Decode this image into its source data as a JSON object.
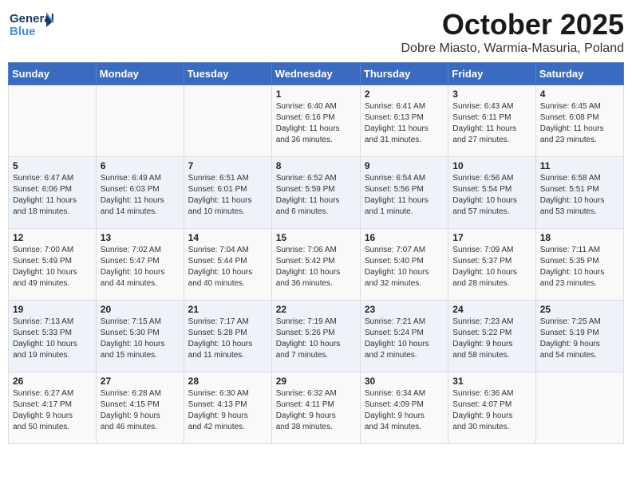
{
  "logo": {
    "line1": "General",
    "line2": "Blue"
  },
  "title": "October 2025",
  "subtitle": "Dobre Miasto, Warmia-Masuria, Poland",
  "days_of_week": [
    "Sunday",
    "Monday",
    "Tuesday",
    "Wednesday",
    "Thursday",
    "Friday",
    "Saturday"
  ],
  "weeks": [
    [
      {
        "day": "",
        "info": ""
      },
      {
        "day": "",
        "info": ""
      },
      {
        "day": "",
        "info": ""
      },
      {
        "day": "1",
        "info": "Sunrise: 6:40 AM\nSunset: 6:16 PM\nDaylight: 11 hours\nand 36 minutes."
      },
      {
        "day": "2",
        "info": "Sunrise: 6:41 AM\nSunset: 6:13 PM\nDaylight: 11 hours\nand 31 minutes."
      },
      {
        "day": "3",
        "info": "Sunrise: 6:43 AM\nSunset: 6:11 PM\nDaylight: 11 hours\nand 27 minutes."
      },
      {
        "day": "4",
        "info": "Sunrise: 6:45 AM\nSunset: 6:08 PM\nDaylight: 11 hours\nand 23 minutes."
      }
    ],
    [
      {
        "day": "5",
        "info": "Sunrise: 6:47 AM\nSunset: 6:06 PM\nDaylight: 11 hours\nand 18 minutes."
      },
      {
        "day": "6",
        "info": "Sunrise: 6:49 AM\nSunset: 6:03 PM\nDaylight: 11 hours\nand 14 minutes."
      },
      {
        "day": "7",
        "info": "Sunrise: 6:51 AM\nSunset: 6:01 PM\nDaylight: 11 hours\nand 10 minutes."
      },
      {
        "day": "8",
        "info": "Sunrise: 6:52 AM\nSunset: 5:59 PM\nDaylight: 11 hours\nand 6 minutes."
      },
      {
        "day": "9",
        "info": "Sunrise: 6:54 AM\nSunset: 5:56 PM\nDaylight: 11 hours\nand 1 minute."
      },
      {
        "day": "10",
        "info": "Sunrise: 6:56 AM\nSunset: 5:54 PM\nDaylight: 10 hours\nand 57 minutes."
      },
      {
        "day": "11",
        "info": "Sunrise: 6:58 AM\nSunset: 5:51 PM\nDaylight: 10 hours\nand 53 minutes."
      }
    ],
    [
      {
        "day": "12",
        "info": "Sunrise: 7:00 AM\nSunset: 5:49 PM\nDaylight: 10 hours\nand 49 minutes."
      },
      {
        "day": "13",
        "info": "Sunrise: 7:02 AM\nSunset: 5:47 PM\nDaylight: 10 hours\nand 44 minutes."
      },
      {
        "day": "14",
        "info": "Sunrise: 7:04 AM\nSunset: 5:44 PM\nDaylight: 10 hours\nand 40 minutes."
      },
      {
        "day": "15",
        "info": "Sunrise: 7:06 AM\nSunset: 5:42 PM\nDaylight: 10 hours\nand 36 minutes."
      },
      {
        "day": "16",
        "info": "Sunrise: 7:07 AM\nSunset: 5:40 PM\nDaylight: 10 hours\nand 32 minutes."
      },
      {
        "day": "17",
        "info": "Sunrise: 7:09 AM\nSunset: 5:37 PM\nDaylight: 10 hours\nand 28 minutes."
      },
      {
        "day": "18",
        "info": "Sunrise: 7:11 AM\nSunset: 5:35 PM\nDaylight: 10 hours\nand 23 minutes."
      }
    ],
    [
      {
        "day": "19",
        "info": "Sunrise: 7:13 AM\nSunset: 5:33 PM\nDaylight: 10 hours\nand 19 minutes."
      },
      {
        "day": "20",
        "info": "Sunrise: 7:15 AM\nSunset: 5:30 PM\nDaylight: 10 hours\nand 15 minutes."
      },
      {
        "day": "21",
        "info": "Sunrise: 7:17 AM\nSunset: 5:28 PM\nDaylight: 10 hours\nand 11 minutes."
      },
      {
        "day": "22",
        "info": "Sunrise: 7:19 AM\nSunset: 5:26 PM\nDaylight: 10 hours\nand 7 minutes."
      },
      {
        "day": "23",
        "info": "Sunrise: 7:21 AM\nSunset: 5:24 PM\nDaylight: 10 hours\nand 2 minutes."
      },
      {
        "day": "24",
        "info": "Sunrise: 7:23 AM\nSunset: 5:22 PM\nDaylight: 9 hours\nand 58 minutes."
      },
      {
        "day": "25",
        "info": "Sunrise: 7:25 AM\nSunset: 5:19 PM\nDaylight: 9 hours\nand 54 minutes."
      }
    ],
    [
      {
        "day": "26",
        "info": "Sunrise: 6:27 AM\nSunset: 4:17 PM\nDaylight: 9 hours\nand 50 minutes."
      },
      {
        "day": "27",
        "info": "Sunrise: 6:28 AM\nSunset: 4:15 PM\nDaylight: 9 hours\nand 46 minutes."
      },
      {
        "day": "28",
        "info": "Sunrise: 6:30 AM\nSunset: 4:13 PM\nDaylight: 9 hours\nand 42 minutes."
      },
      {
        "day": "29",
        "info": "Sunrise: 6:32 AM\nSunset: 4:11 PM\nDaylight: 9 hours\nand 38 minutes."
      },
      {
        "day": "30",
        "info": "Sunrise: 6:34 AM\nSunset: 4:09 PM\nDaylight: 9 hours\nand 34 minutes."
      },
      {
        "day": "31",
        "info": "Sunrise: 6:36 AM\nSunset: 4:07 PM\nDaylight: 9 hours\nand 30 minutes."
      },
      {
        "day": "",
        "info": ""
      }
    ]
  ]
}
